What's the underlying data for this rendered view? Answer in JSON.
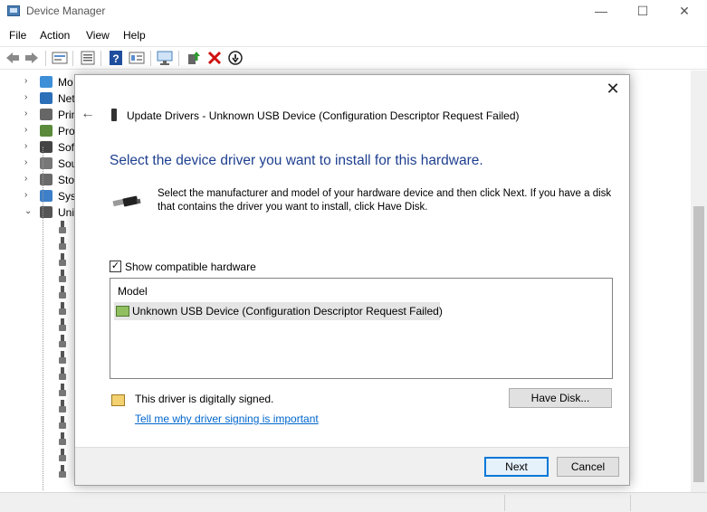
{
  "window": {
    "title": "Device Manager",
    "controls": {
      "minimize": "—",
      "maximize": "☐",
      "close": "✕"
    }
  },
  "menu": [
    "File",
    "Action",
    "View",
    "Help"
  ],
  "toolbar": {
    "icons": [
      "back-icon",
      "forward-icon",
      "properties-icon",
      "details-icon",
      "help-icon",
      "view-icon",
      "scan-icon",
      "update-driver-icon",
      "uninstall-icon",
      "disable-icon"
    ]
  },
  "tree": {
    "items": [
      {
        "expander": "›",
        "label": "Mo",
        "icon_color": "#3d8fd8"
      },
      {
        "expander": "›",
        "label": "Net",
        "icon_color": "#2b6fb8"
      },
      {
        "expander": "›",
        "label": "Prin",
        "icon_color": "#666666"
      },
      {
        "expander": "›",
        "label": "Pro",
        "icon_color": "#5a8a3a"
      },
      {
        "expander": "›",
        "label": "Sof",
        "icon_color": "#444444"
      },
      {
        "expander": "›",
        "label": "Sou",
        "icon_color": "#777777"
      },
      {
        "expander": "›",
        "label": "Sto",
        "icon_color": "#6a6a6a"
      },
      {
        "expander": "›",
        "label": "Sys",
        "icon_color": "#3d7fc8"
      },
      {
        "expander": "⌄",
        "label": "Uni",
        "icon_color": "#555555"
      }
    ],
    "usb_children_count_visible": 16
  },
  "dialog": {
    "close": "✕",
    "back": "←",
    "title": "Update Drivers - Unknown USB Device (Configuration Descriptor Request Failed)",
    "heading": "Select the device driver you want to install for this hardware.",
    "description": "Select the manufacturer and model of your hardware device and then click Next. If you have a disk that contains the driver you want to install, click Have Disk.",
    "show_compatible": {
      "label": "Show compatible hardware",
      "checked": true,
      "mark": "✓"
    },
    "model_list": {
      "header": "Model",
      "items": [
        "Unknown USB Device (Configuration Descriptor Request Failed)"
      ]
    },
    "signed_text": "This driver is digitally signed.",
    "signing_link": "Tell me why driver signing is important",
    "have_disk_label": "Have Disk...",
    "next_label": "Next",
    "cancel_label": "Cancel"
  },
  "colors": {
    "heading": "#1e3f8f",
    "link": "#0066cc",
    "accent": "#0078d7"
  }
}
